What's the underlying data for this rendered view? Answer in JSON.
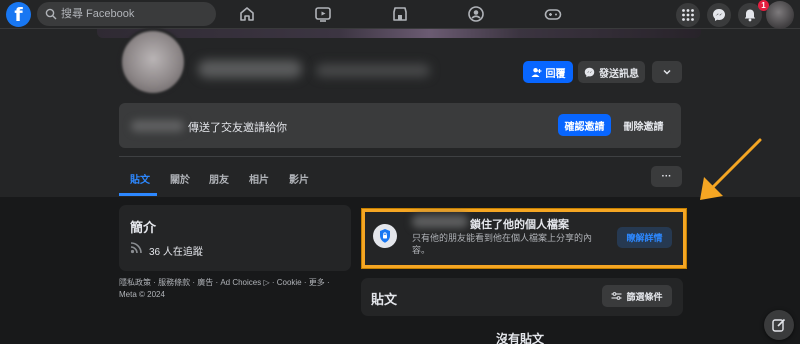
{
  "topbar": {
    "logo": "f",
    "search_placeholder": "搜尋 Facebook",
    "nav_icons": [
      "home-icon",
      "video-icon",
      "marketplace-icon",
      "groups-icon",
      "gaming-icon"
    ],
    "right_icons": [
      "menu-grid-icon",
      "messenger-icon",
      "notifications-icon"
    ],
    "notification_count": "1"
  },
  "profile": {
    "actions": {
      "reply_label": "回覆",
      "message_label": "發送訊息",
      "more_label": "⌄"
    },
    "friend_request": {
      "text": "傳送了交友邀請給你",
      "confirm_label": "確認邀請",
      "delete_label": "刪除邀請"
    },
    "tabs": [
      {
        "label": "貼文",
        "active": true
      },
      {
        "label": "關於",
        "active": false
      },
      {
        "label": "朋友",
        "active": false
      },
      {
        "label": "相片",
        "active": false
      },
      {
        "label": "影片",
        "active": false
      }
    ],
    "tabs_more_label": "···"
  },
  "intro": {
    "title": "簡介",
    "followers_text": "36 人在追蹤",
    "footer": "隱私政策 · 服務條款 · 廣告 · Ad Choices ▷ · Cookie · 更多 · Meta © 2024"
  },
  "locked": {
    "title": "鎖住了他的個人檔案",
    "description": "只有他的朋友能看到他在個人檔案上分享的內容。",
    "learn_more_label": "瞭解詳情"
  },
  "posts": {
    "title": "貼文",
    "filter_label": "篩選條件",
    "empty_text": "沒有貼文"
  },
  "colors": {
    "accent": "#0866ff",
    "highlight": "#f5a623",
    "background": "#18191a",
    "surface": "#242526"
  }
}
